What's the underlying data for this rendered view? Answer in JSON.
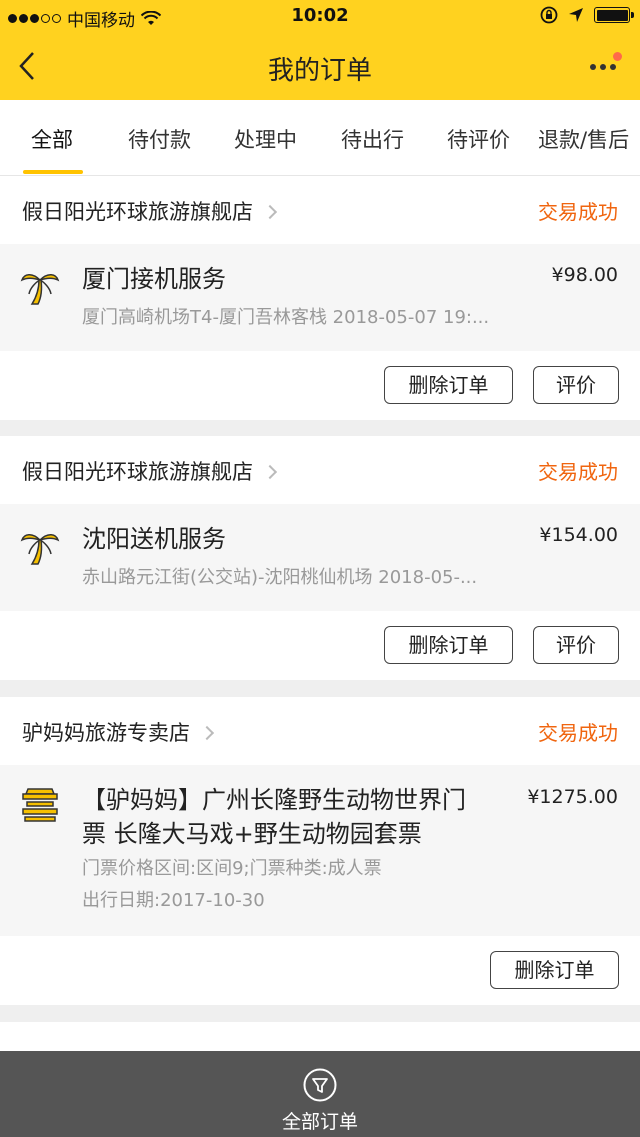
{
  "status_bar": {
    "carrier": "中国移动",
    "time": "10:02"
  },
  "header": {
    "title": "我的订单"
  },
  "tabs": [
    {
      "label": "全部",
      "active": true
    },
    {
      "label": "待付款"
    },
    {
      "label": "处理中"
    },
    {
      "label": "待出行"
    },
    {
      "label": "待评价"
    },
    {
      "label": "退款/售后"
    }
  ],
  "orders": [
    {
      "shop": "假日阳光环球旅游旗舰店",
      "status": "交易成功",
      "icon": "palm-tree-icon",
      "title_line1": "厦门接机服务",
      "price": "¥98.00",
      "sub_line1": "厦门高崎机场T4-厦门吾林客栈 2018-05-07 19:...",
      "actions": [
        "删除订单",
        "评价"
      ]
    },
    {
      "shop": "假日阳光环球旅游旗舰店",
      "status": "交易成功",
      "icon": "palm-tree-icon",
      "title_line1": "沈阳送机服务",
      "price": "¥154.00",
      "sub_line1": "赤山路元江街(公交站)-沈阳桃仙机场 2018-05-...",
      "actions": [
        "删除订单",
        "评价"
      ]
    },
    {
      "shop": "驴妈妈旅游专卖店",
      "status": "交易成功",
      "icon": "ticket-gate-icon",
      "title_line1": "【驴妈妈】广州长隆野生动物世界门",
      "title_line2": "票 长隆大马戏+野生动物园套票",
      "price": "¥1275.00",
      "sub_line1": "门票价格区间:区间9;门票种类:成人票",
      "sub_line2": "出行日期:2017-10-30",
      "actions": [
        "删除订单"
      ]
    }
  ],
  "bottom_bar": {
    "label": "全部订单",
    "icon": "filter-icon"
  },
  "colors": {
    "header": "#ffd21f",
    "status_success": "#f0650f",
    "tab_indicator": "#ffc300",
    "bottom_bar": "#555555"
  }
}
